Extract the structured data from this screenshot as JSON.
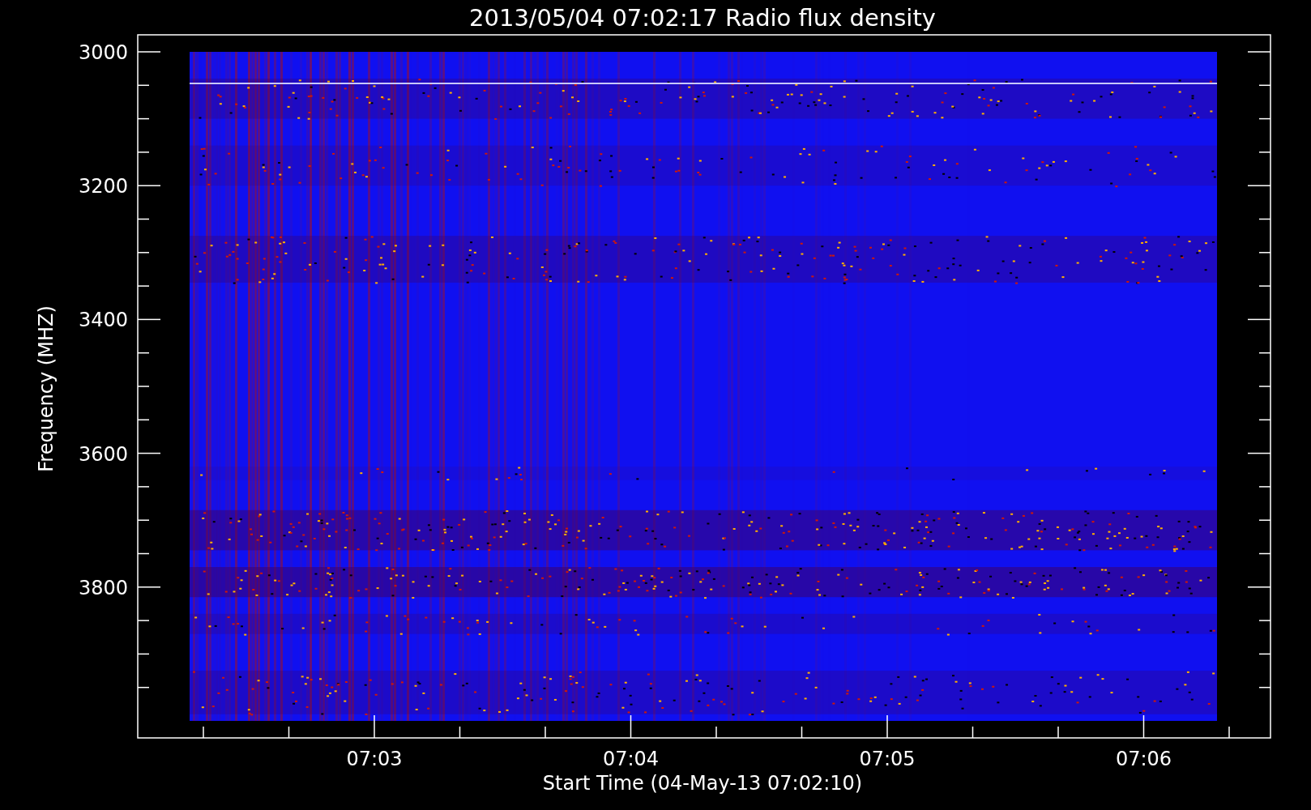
{
  "title": "2013/05/04 07:02:17 Radio flux density",
  "y_axis": {
    "label": "Frequency (MHZ)",
    "ticks": [
      "3000",
      "3200",
      "3400",
      "3600",
      "3800"
    ]
  },
  "x_axis": {
    "label": "Start Time (04-May-13 07:02:10)",
    "ticks": [
      "07:03",
      "07:04",
      "07:05",
      "07:06"
    ]
  }
}
